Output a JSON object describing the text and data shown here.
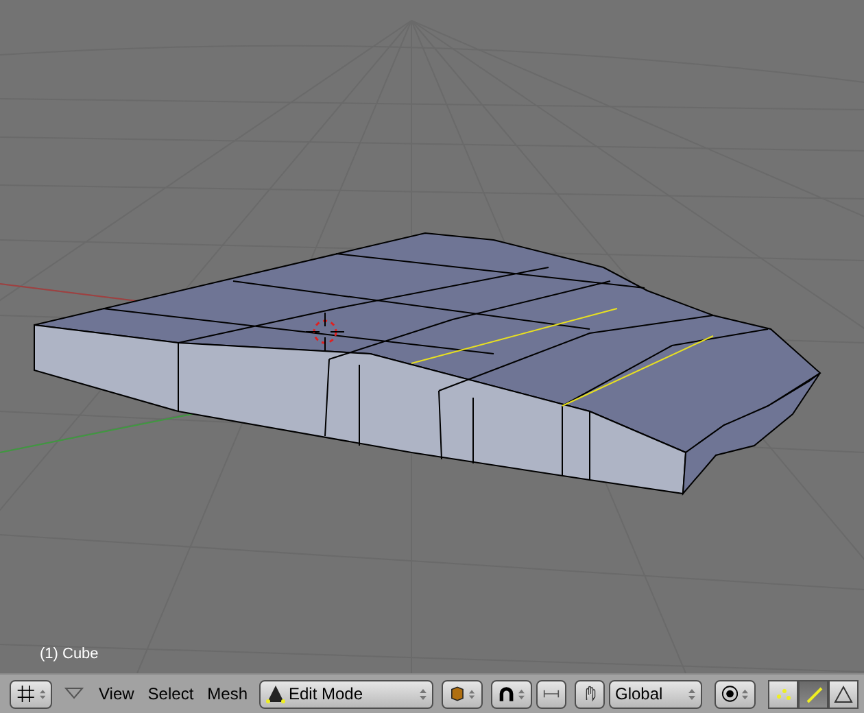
{
  "viewport": {
    "object_label": "(1) Cube"
  },
  "header": {
    "menus": [
      "View",
      "Select",
      "Mesh"
    ],
    "mode": "Edit Mode",
    "orientation": "Global",
    "select_modes": [
      {
        "kind": "vertex",
        "selected": false
      },
      {
        "kind": "edge",
        "selected": true
      },
      {
        "kind": "face",
        "selected": false
      }
    ]
  }
}
